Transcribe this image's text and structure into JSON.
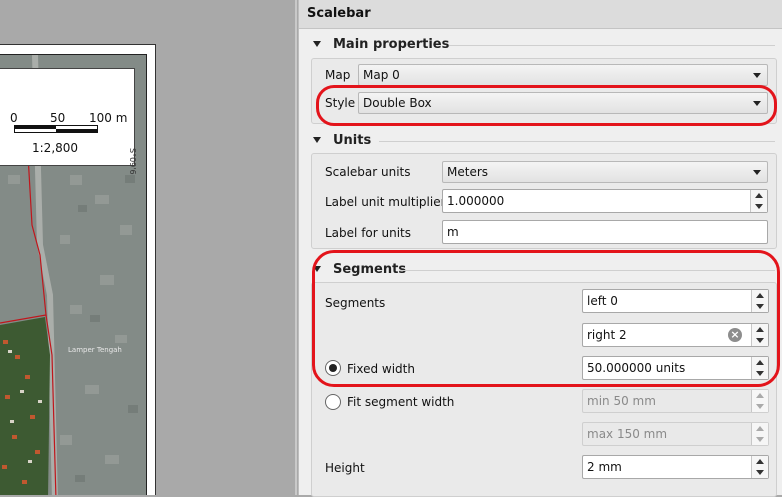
{
  "canvas": {
    "scalebar_ticks": [
      "0",
      "50",
      "100 m"
    ],
    "scalebar_ratio": "1:2,800",
    "coord_label": "S°09'6",
    "place_label": "Lamper Tengah"
  },
  "panel": {
    "title": "Scalebar",
    "main": {
      "heading": "Main properties",
      "map_label": "Map",
      "map_value": "Map 0",
      "style_label": "Style",
      "style_value": "Double Box"
    },
    "units": {
      "heading": "Units",
      "scalebar_units_label": "Scalebar units",
      "scalebar_units_value": "Meters",
      "multiplier_label": "Label unit multiplier",
      "multiplier_value": "1.000000",
      "label_units_label": "Label for units",
      "label_units_value": "m"
    },
    "segments": {
      "heading": "Segments",
      "segments_label": "Segments",
      "left_value": "left 0",
      "right_value": "right 2",
      "fixed_width_label": "Fixed width",
      "fixed_width_value": "50.000000 units",
      "fit_width_label": "Fit segment width",
      "min_value": "min 50 mm",
      "max_value": "max 150 mm",
      "height_label": "Height",
      "height_value": "2 mm"
    }
  }
}
